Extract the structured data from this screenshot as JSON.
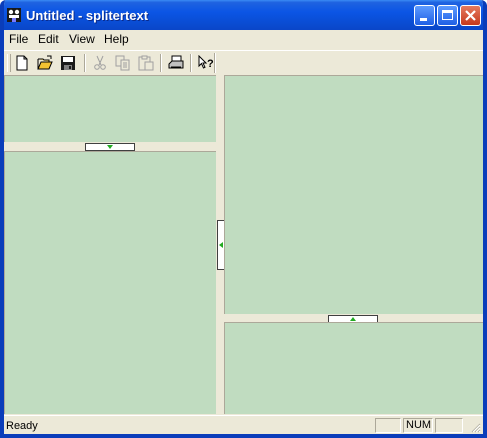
{
  "window": {
    "title": "Untitled - splitertext",
    "icon": "app-figure-icon",
    "controls": [
      "minimize-icon",
      "maximize-icon",
      "close-icon"
    ],
    "accent_color": "#0a4ed6",
    "close_color": "#c6391d"
  },
  "menu": {
    "items": [
      {
        "label": "File"
      },
      {
        "label": "Edit"
      },
      {
        "label": "View"
      },
      {
        "label": "Help"
      }
    ]
  },
  "toolbar": {
    "buttons": [
      {
        "icon": "new-document-icon",
        "enabled": true
      },
      {
        "icon": "open-folder-icon",
        "enabled": true
      },
      {
        "icon": "save-disk-icon",
        "enabled": true
      },
      {
        "icon": "cut-scissors-icon",
        "enabled": false
      },
      {
        "icon": "copy-icon",
        "enabled": false
      },
      {
        "icon": "paste-icon",
        "enabled": false
      },
      {
        "icon": "print-icon",
        "enabled": true
      },
      {
        "icon": "help-pointer-icon",
        "enabled": true
      }
    ]
  },
  "panes": {
    "background_color": "#c0dcc0",
    "splitter_arrow_color": "#22aa22"
  },
  "status": {
    "text": "Ready",
    "indicators": [
      "",
      "NUM",
      ""
    ]
  }
}
